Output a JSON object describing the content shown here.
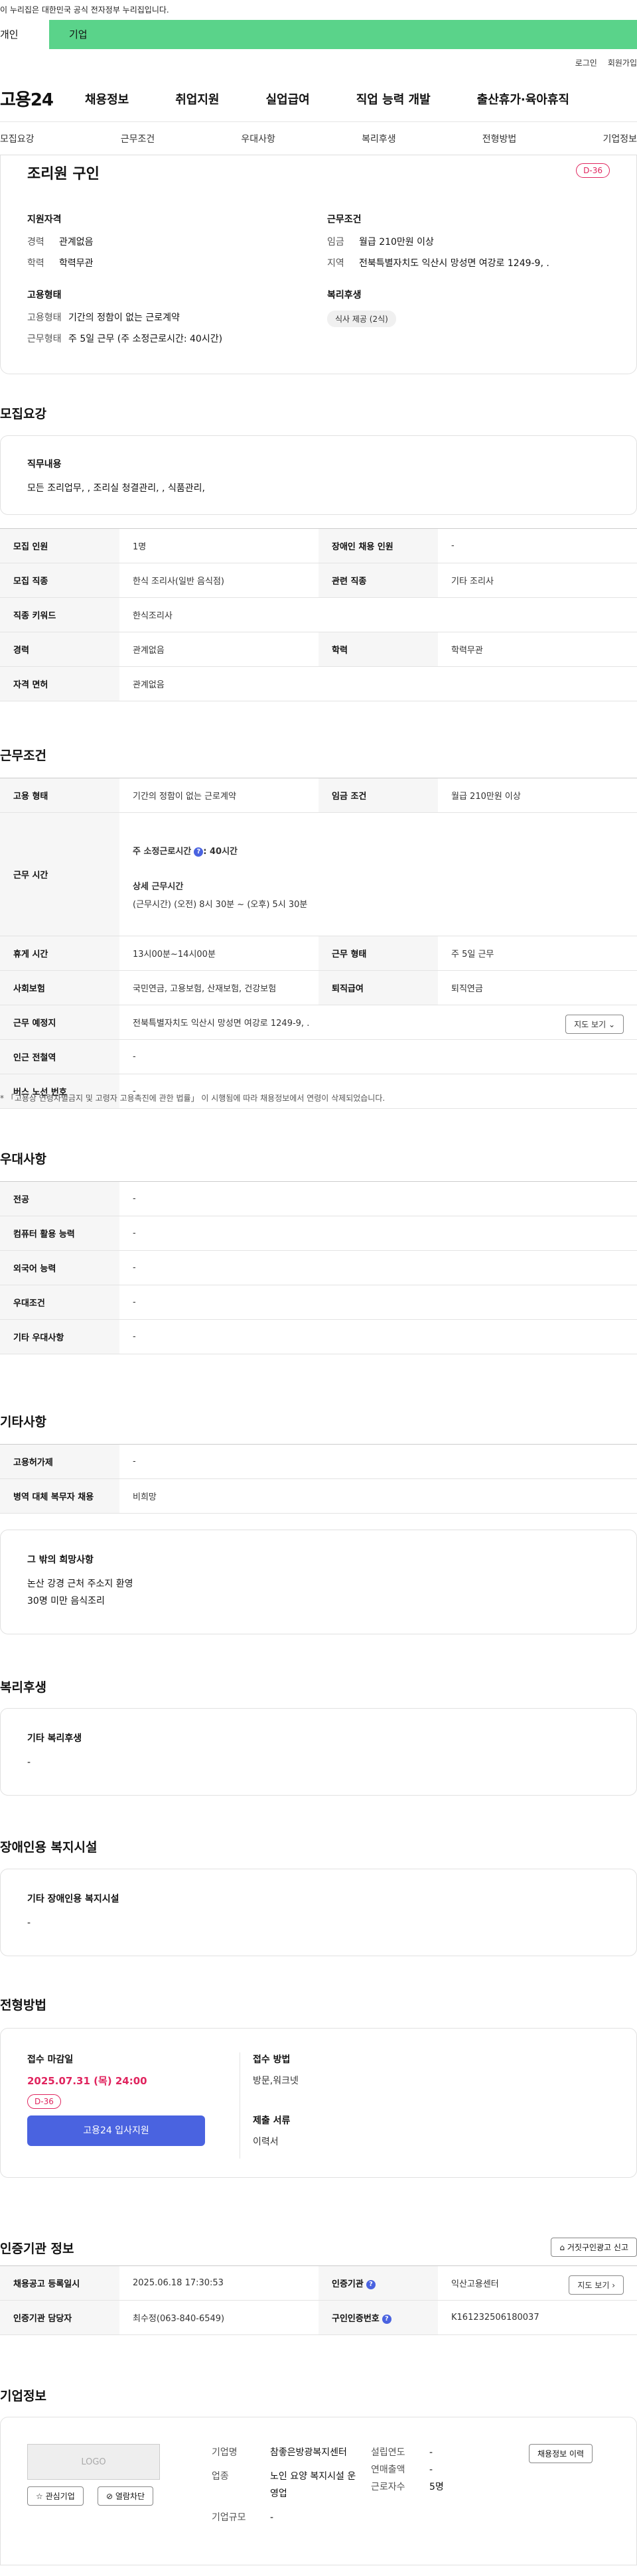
{
  "gov_bar": "이 누리집은 대한민국 공식 전자정부 누리집입니다.",
  "site_tabs": {
    "personal": "개인",
    "enterprise": "기업"
  },
  "util": {
    "login": "로그인",
    "signup": "회원가입"
  },
  "logo": "고용24",
  "gnb": [
    "채용정보",
    "취업지원",
    "실업급여",
    "직업 능력 개발",
    "출산휴가·육아휴직"
  ],
  "anchors": [
    "모집요강",
    "근무조건",
    "우대사항",
    "복리후생",
    "전형방법",
    "기업정보"
  ],
  "summary": {
    "title": "조리원 구인",
    "dday": "D-36",
    "qual_title": "지원자격",
    "career_k": "경력",
    "career_v": "관계없음",
    "edu_k": "학력",
    "edu_v": "학력무관",
    "cond_title": "근무조건",
    "wage_k": "임금",
    "wage_v": "월급 210만원 이상",
    "area_k": "지역",
    "area_v": "전북특별자치도 익산시 망성면 여강로 1249-9, .",
    "emp_title": "고용형태",
    "emp_k": "고용형태",
    "emp_v": "기간의 정함이 없는 근로계약",
    "worktype_k": "근무형태",
    "worktype_v": "주 5일 근무 (주 소정근로시간: 40시간)",
    "welfare_title": "복리후생",
    "welfare_pill": "식사 제공 (2식)"
  },
  "recruit": {
    "title": "모집요강",
    "duty_title": "직무내용",
    "duty_text": "모든 조리업무, , 조리실 청결관리, , 식품관리,",
    "rows": [
      [
        "모집 인원",
        "1명",
        "장애인 채용 인원",
        "-"
      ],
      [
        "모집 직종",
        "한식 조리사(일반 음식점)",
        "관련 직종",
        "기타 조리사"
      ],
      [
        "직종 키워드",
        "한식조리사",
        "",
        ""
      ],
      [
        "경력",
        "관계없음",
        "학력",
        "학력무관"
      ],
      [
        "자격 면허",
        "관계없음",
        "",
        ""
      ]
    ]
  },
  "work": {
    "title": "근무조건",
    "emp_h": "고용 형태",
    "emp_v": "기간의 정함이 없는 근로계약",
    "wage_h": "임금 조건",
    "wage_v": "월급 210만원 이상",
    "time_h": "근무 시간",
    "time_week": "주 소정근로시간",
    "time_week_v": ": 40시간",
    "time_detail_t": "상세 근무시간",
    "time_detail_v": "(근무시간) (오전) 8시 30분 ~ (오후) 5시 30분",
    "rest_h": "휴게 시간",
    "rest_v": "13시00분~14시00분",
    "form_h": "근무 형태",
    "form_v": "주 5일 근무",
    "ins_h": "사회보험",
    "ins_v": "국민연금, 고용보험, 산재보험, 건강보험",
    "ret_h": "퇴직급여",
    "ret_v": "퇴직연금",
    "place_h": "근무 예정지",
    "place_v": "전북특별자치도 익산시 망성면 여강로 1249-9, .",
    "map_btn": "지도 보기",
    "sub_h": "인근 전철역",
    "sub_v": "-",
    "bus_h": "버스 노선 번호",
    "bus_v": "-",
    "note": "* 「고용상 연령차별금지 및 고령자 고용촉진에 관한 법률」 이 시행됨에 따라 채용정보에서 연령이 삭제되었습니다."
  },
  "pref": {
    "title": "우대사항",
    "rows": [
      [
        "전공",
        "-"
      ],
      [
        "컴퓨터 활용 능력",
        "-"
      ],
      [
        "외국어 능력",
        "-"
      ],
      [
        "우대조건",
        "-"
      ],
      [
        "기타 우대사항",
        "-"
      ]
    ]
  },
  "etc": {
    "title": "기타사항",
    "rows": [
      [
        "고용허가제",
        "-"
      ],
      [
        "병역 대체 복무자 채용",
        "비희망"
      ]
    ],
    "hope_title": "그 밖의 희망사항",
    "hope_l1": "논산 강경 근처 주소지 환영",
    "hope_l2": "30명 미만 음식조리"
  },
  "welfare": {
    "title": "복리후생",
    "box_title": "기타 복리후생",
    "box_v": "-"
  },
  "disabled": {
    "title": "장애인용 복지시설",
    "box_title": "기타 장애인용 복지시설",
    "box_v": "-"
  },
  "screening": {
    "title": "전형방법",
    "deadline_t": "접수 마감일",
    "deadline_v": "2025.07.31 (목) 24:00",
    "dday": "D-36",
    "apply_btn": "고용24 입사지원",
    "method_t": "접수 방법",
    "method_v": "방문,워크넷",
    "docs_t": "제출 서류",
    "docs_v": "이력서"
  },
  "agency": {
    "title": "인증기관 정보",
    "report_btn": "거짓구인광고 신고",
    "reg_h": "채용공고 등록일시",
    "reg_v": "2025.06.18 17:30:53",
    "org_h": "인증기관",
    "org_v": "익산고용센터",
    "map_btn": "지도 보기",
    "mgr_h": "인증기관 담당자",
    "mgr_v": "최수정(063-840-6549)",
    "num_h": "구인인증번호",
    "num_v": "K161232506180037"
  },
  "company": {
    "title": "기업정보",
    "logo_text": "LOGO",
    "fav_btn": "관심기업",
    "block_btn": "열람차단",
    "name_k": "기업명",
    "name_v": "참좋은방광복지센터",
    "ind_k": "업종",
    "ind_v": "노인 요양 복지시설 운영업",
    "size_k": "기업규모",
    "size_v": "-",
    "year_k": "설립연도",
    "year_v": "-",
    "sales_k": "연매출액",
    "sales_v": "-",
    "emp_k": "근로자수",
    "emp_v": "5명",
    "history_btn": "채용정보 이력"
  },
  "colors": {
    "green": "#5ad38a",
    "primary": "#4a63e0",
    "dday": "#e0245e"
  }
}
